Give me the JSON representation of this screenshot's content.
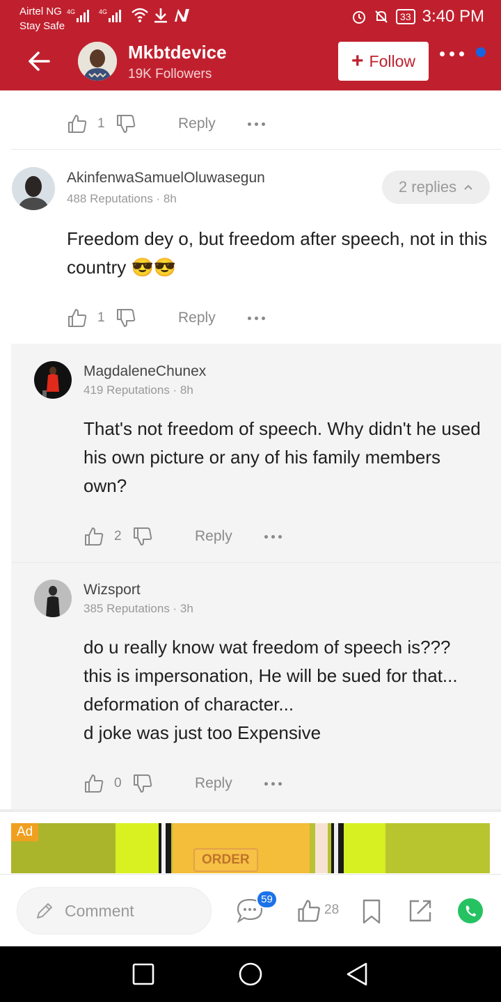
{
  "status_bar": {
    "carrier": "Airtel NG",
    "carrier_sub": "Stay Safe",
    "network_1": "4G",
    "network_2": "4G",
    "battery": "33",
    "time": "3:40 PM"
  },
  "header": {
    "author_name": "Mkbtdevice",
    "followers": "19K Followers",
    "follow_label": "Follow",
    "accent_color": "#c0202e"
  },
  "top_actions": {
    "likes": "1",
    "reply_label": "Reply"
  },
  "comment": {
    "author": "AkinfenwaSamuelOluwasegun",
    "meta": "488 Reputations · 8h",
    "text": "Freedom dey o, but freedom after speech, not in this country 😎😎",
    "replies_label": "2 replies",
    "likes": "1",
    "reply_label": "Reply"
  },
  "replies": [
    {
      "author": "MagdaleneChunex",
      "meta": "419 Reputations · 8h",
      "text": "That's not freedom of speech. Why didn't he used his own picture or any of his family members own?",
      "likes": "2",
      "reply_label": "Reply"
    },
    {
      "author": "Wizsport",
      "meta": "385 Reputations · 3h",
      "text_lines": [
        "do u really know wat freedom of speech is???",
        "this is impersonation, He will be sued for that...",
        "deformation of character...",
        "d joke was just too Expensive"
      ],
      "likes": "0",
      "reply_label": "Reply"
    }
  ],
  "ad": {
    "badge": "Ad",
    "button_text": "ORDER"
  },
  "bottom_bar": {
    "comment_placeholder": "Comment",
    "comment_count": "59",
    "like_count": "28"
  },
  "icons": [
    "back-arrow-icon",
    "plus-icon",
    "more-dots-icon",
    "thumbs-up-icon",
    "thumbs-down-icon",
    "pencil-icon",
    "chat-icon",
    "bookmark-icon",
    "share-icon",
    "whatsapp-icon",
    "square-nav-icon",
    "circle-nav-icon",
    "triangle-back-nav-icon"
  ]
}
